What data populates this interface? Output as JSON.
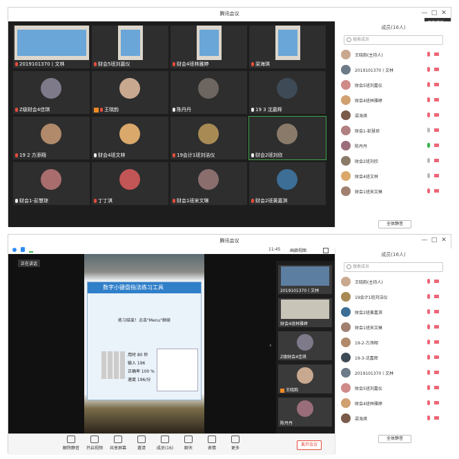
{
  "top": {
    "title": "腾讯会议",
    "controls": [
      "—",
      "□",
      "✕"
    ],
    "tooltip": "正在讲话：",
    "tiles": [
      {
        "label": "2019101370丨文林",
        "mic": "muted",
        "kind": "screen",
        "color": "#6aa6d8"
      },
      {
        "label": "财会5班刘嘉仪",
        "mic": "muted",
        "kind": "screen",
        "color": "#6aa6d8"
      },
      {
        "label": "财会4班林雅婷",
        "mic": "muted",
        "kind": "screen",
        "color": "#6aa6d8"
      },
      {
        "label": "梁海琪",
        "mic": "muted",
        "kind": "screen",
        "color": "#6aa6d8"
      },
      {
        "label": "Z级财会4佳琪",
        "mic": "muted",
        "kind": "avatar",
        "color": "#7e7a8a"
      },
      {
        "label": "王晓韵",
        "mic": "muted",
        "kind": "avatar",
        "color": "#c9a890",
        "host": true
      },
      {
        "label": "陈丹丹",
        "mic": "on",
        "kind": "avatar",
        "color": "#6d6560"
      },
      {
        "label": "19 3 沈嘉辉",
        "mic": "on",
        "kind": "avatar",
        "color": "#3e4a55"
      },
      {
        "label": "19 2 方添翔",
        "mic": "muted",
        "kind": "avatar",
        "color": "#b08a6a"
      },
      {
        "label": "财会4班文林",
        "mic": "on",
        "kind": "avatar",
        "color": "#d9a86a"
      },
      {
        "label": "19会计1班刘洁仪",
        "mic": "muted",
        "kind": "avatar",
        "color": "#a88a55"
      },
      {
        "label": "财会2班刘欣",
        "mic": "on",
        "kind": "avatar",
        "color": "#8a7a6a",
        "highlight": true
      },
      {
        "label": "财会1-彭慧琼",
        "mic": "on",
        "kind": "avatar",
        "color": "#a96d6d"
      },
      {
        "label": "丁丁淇",
        "mic": "muted",
        "kind": "avatar",
        "color": "#c25555"
      },
      {
        "label": "财会1班宋文琳",
        "mic": "muted",
        "kind": "avatar",
        "color": "#8a6d6d"
      },
      {
        "label": "财会2班黄嘉淇",
        "mic": "muted",
        "kind": "avatar",
        "color": "#3c6e96"
      }
    ],
    "participants": {
      "header": "成员(16人)",
      "search_placeholder": "搜索成员",
      "items": [
        {
          "name": "王晓韵(主持人)",
          "mic": "muted",
          "color": "#c9a890"
        },
        {
          "name": "2019101370丨文林",
          "mic": "muted",
          "color": "#6d7a88"
        },
        {
          "name": "财会5班刘嘉仪",
          "mic": "muted",
          "color": "#d08a8a"
        },
        {
          "name": "财会4班林雅婷",
          "mic": "muted",
          "color": "#d0a070"
        },
        {
          "name": "梁海琪",
          "mic": "muted",
          "color": "#7a5a4a"
        },
        {
          "name": "财会1-彭慧琼",
          "mic": "on",
          "color": "#b08080"
        },
        {
          "name": "陈丹丹",
          "mic": "active",
          "color": "#9a6d7a"
        },
        {
          "name": "财会2班刘欣",
          "mic": "on",
          "color": "#8a7a6a"
        },
        {
          "name": "财会4班文林",
          "mic": "on",
          "color": "#d9a86a"
        },
        {
          "name": "财会1班宋文琳",
          "mic": "muted",
          "color": "#a08070"
        }
      ],
      "button": "全体静音"
    }
  },
  "bottom": {
    "title": "腾讯会议",
    "time": "11:45",
    "view_label": "画廊视图",
    "speaker_label": "正在讲话",
    "app": {
      "title": "数字小键盘指法练习工具",
      "message": "练习结束！点击\"Menu\"继续",
      "stats": [
        "用时 80 秒",
        "输入 196",
        "正确率 100 %",
        "速度 196/分"
      ]
    },
    "rail": [
      {
        "label": "2019101370丨文林",
        "color": "#5c7ea0"
      },
      {
        "label": "财会4班林雅婷",
        "color": "#c9c4b8"
      },
      {
        "label": "Z级财会4佳琪",
        "color": "#7e7a8a"
      },
      {
        "label": "王晓韵",
        "color": "#c9a890",
        "host": true
      },
      {
        "label": "陈丹丹",
        "color": "#9a6d7a"
      }
    ],
    "toolbar": [
      {
        "label": "解除静音",
        "name": "unmute-button"
      },
      {
        "label": "开启视频",
        "name": "start-video-button"
      },
      {
        "label": "共享屏幕",
        "name": "share-screen-button"
      },
      {
        "label": "邀请",
        "name": "invite-button"
      },
      {
        "label": "成员(16)",
        "name": "participants-button"
      },
      {
        "label": "聊天",
        "name": "chat-button"
      },
      {
        "label": "表情",
        "name": "reactions-button"
      },
      {
        "label": "更多",
        "name": "more-button"
      }
    ],
    "end_label": "离开会议",
    "participants": {
      "header": "成员(16人)",
      "search_placeholder": "搜索成员",
      "items": [
        {
          "name": "王晓韵(主持人)",
          "mic": "muted",
          "color": "#c9a890"
        },
        {
          "name": "19会计1班刘洁仪",
          "mic": "muted",
          "color": "#a88a55"
        },
        {
          "name": "财会2班黄嘉淇",
          "mic": "muted",
          "color": "#3c6e96"
        },
        {
          "name": "财会1班宋文琳",
          "mic": "muted",
          "color": "#a08070"
        },
        {
          "name": "19-2-方添翔",
          "mic": "muted",
          "color": "#b08a6a"
        },
        {
          "name": "19-3-沈嘉辉",
          "mic": "muted",
          "color": "#3e4a55"
        },
        {
          "name": "2019101370丨文林",
          "mic": "muted",
          "color": "#6d7a88"
        },
        {
          "name": "财会5班刘嘉仪",
          "mic": "muted",
          "color": "#d08a8a"
        },
        {
          "name": "财会4班林雅婷",
          "mic": "muted",
          "color": "#d0a070"
        },
        {
          "name": "梁海琪",
          "mic": "muted",
          "color": "#7a5a4a"
        }
      ],
      "button": "全体静音"
    }
  }
}
